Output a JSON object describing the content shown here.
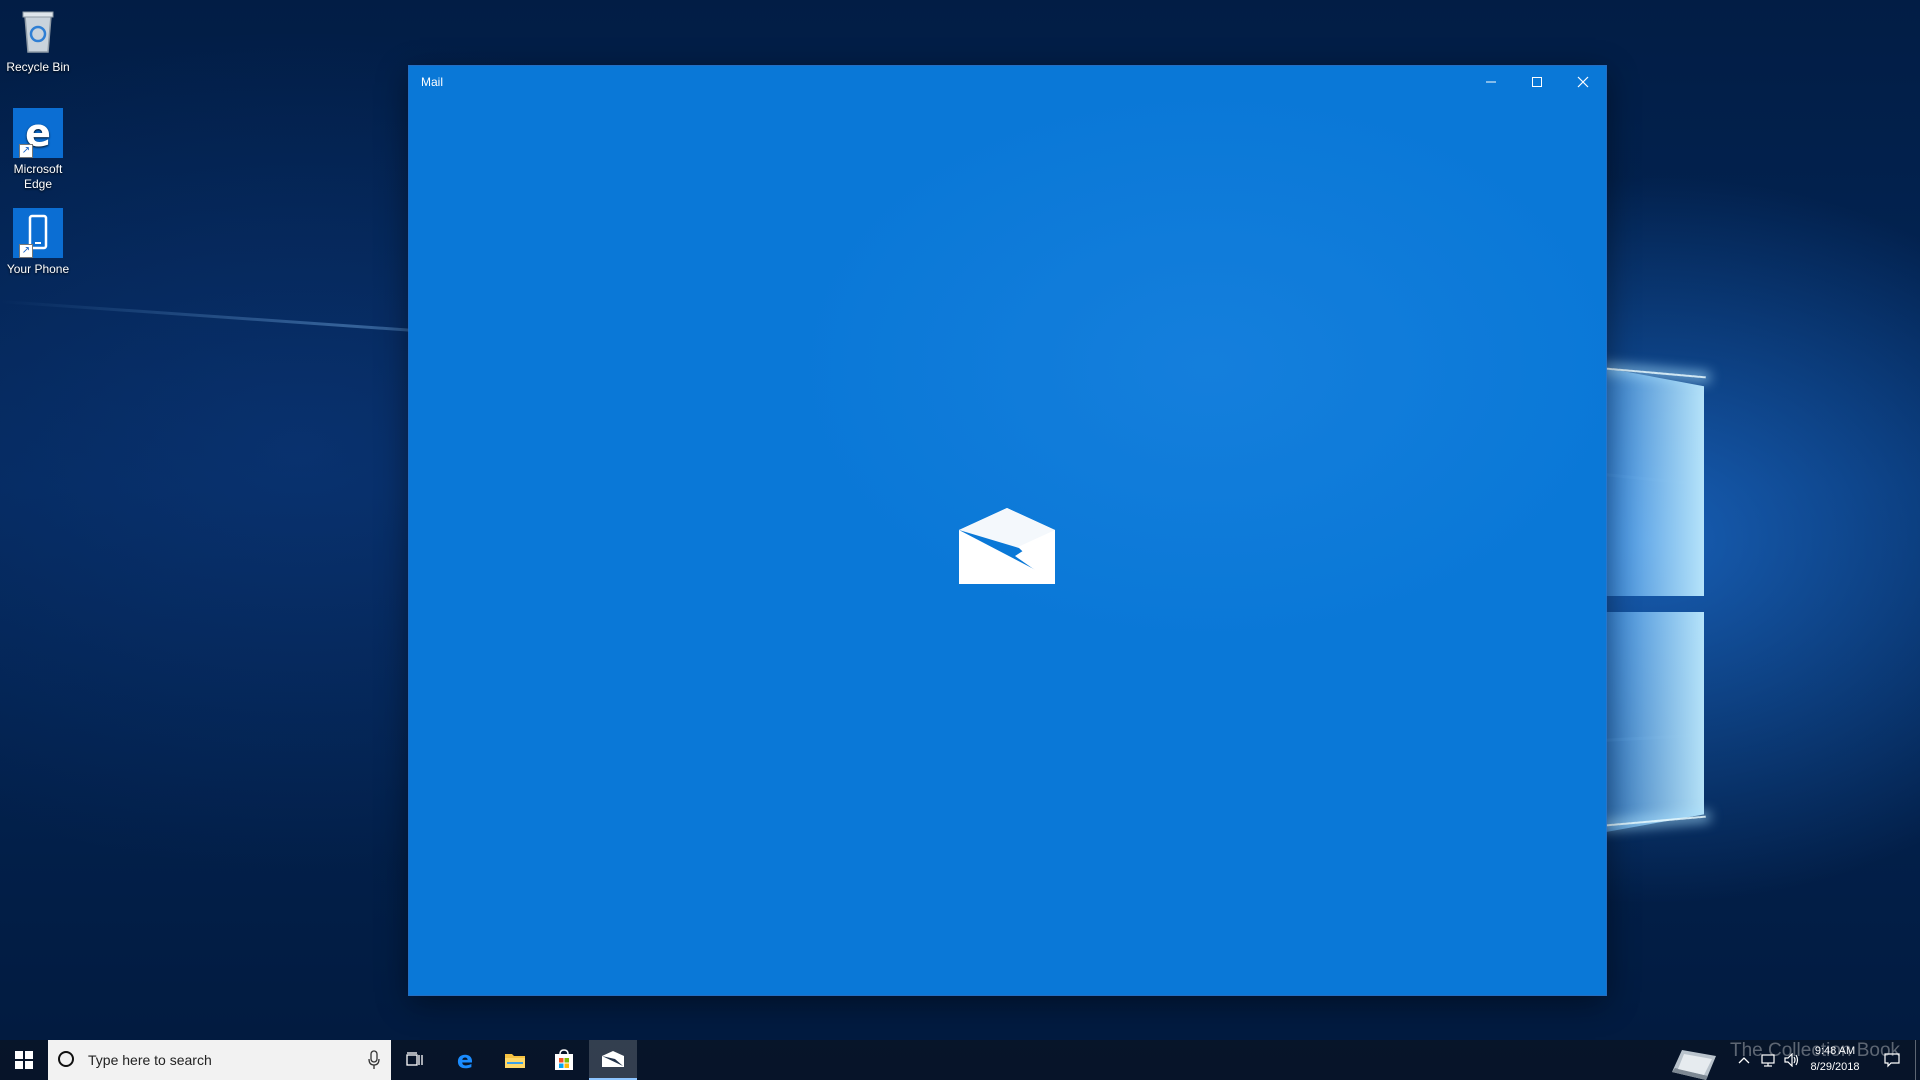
{
  "desktop": {
    "icons": [
      {
        "label": "Recycle Bin",
        "icon": "recycle-bin-icon"
      },
      {
        "label": "Microsoft Edge",
        "icon": "edge-icon"
      },
      {
        "label": "Your Phone",
        "icon": "phone-icon"
      }
    ]
  },
  "window": {
    "title": "Mail",
    "minimize_label": "–",
    "splash_icon": "envelope-icon",
    "accent": "#0a78d7"
  },
  "taskbar": {
    "search_placeholder": "Type here to search",
    "pinned": [
      {
        "name": "task-view",
        "icon": "task-view-icon"
      },
      {
        "name": "edge",
        "icon": "edge-icon"
      },
      {
        "name": "file-explorer",
        "icon": "folder-icon"
      },
      {
        "name": "store",
        "icon": "store-icon"
      },
      {
        "name": "mail",
        "icon": "mail-icon",
        "active": true
      }
    ],
    "clock": {
      "time": "9:48 AM",
      "date": "8/29/2018"
    }
  },
  "watermark": "The Collection Book"
}
